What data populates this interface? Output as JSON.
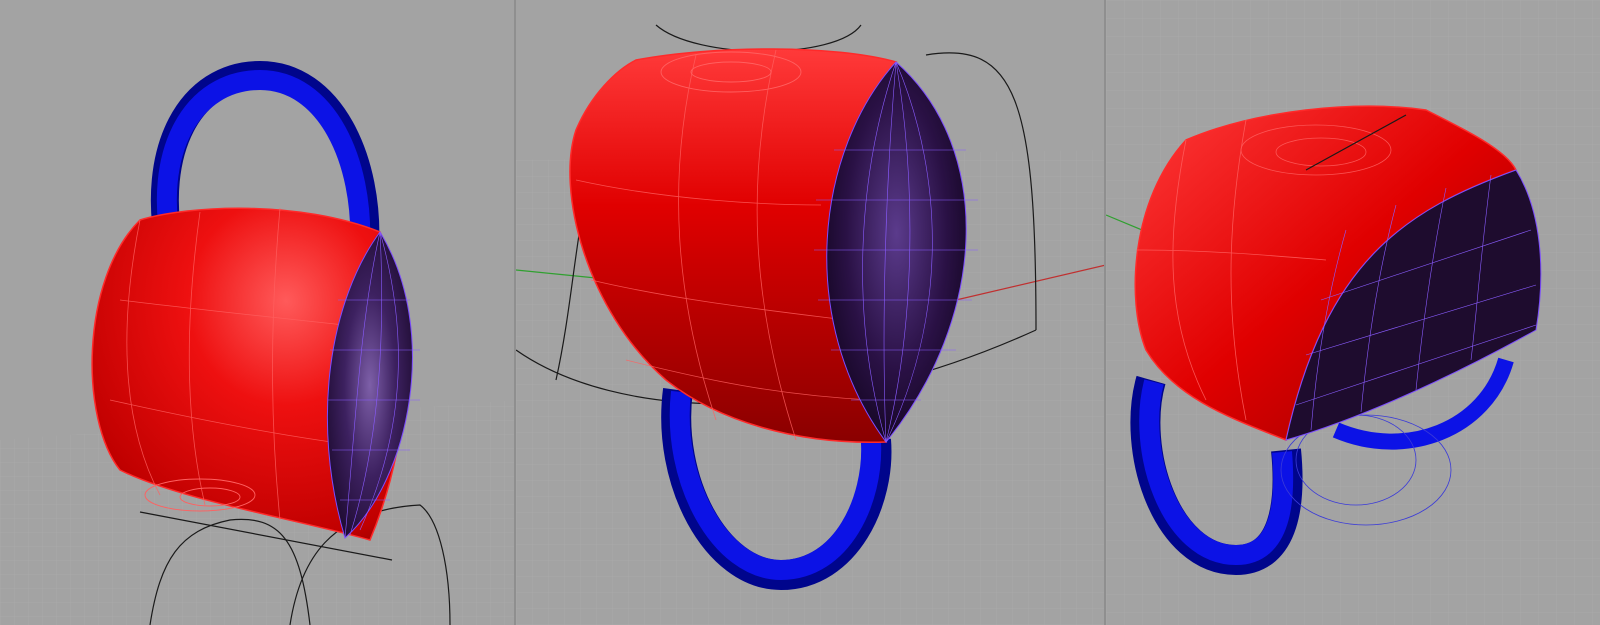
{
  "app": {
    "description_colors": {
      "viewport_background": "#a3a3a3",
      "grid_line": "#b4b4b4",
      "body_surface": "#e00000",
      "body_highlight": "#ff4a4a",
      "body_shadow": "#8a0000",
      "cut_face": "#1e0c2e",
      "cut_face_glow": "#5b3b8c",
      "isocurve_wire": "#7b4cff",
      "ring_band": "#0c12e6",
      "ring_shadow": "#00058c",
      "construction_curve": "#1a1a1a",
      "axis_x": "#c03030",
      "axis_y": "#30a030"
    }
  },
  "viewports": [
    {
      "name": "perspective-left",
      "icon": "ring-model-icon"
    },
    {
      "name": "perspective-center",
      "icon": "ring-model-icon"
    },
    {
      "name": "perspective-right",
      "icon": "ring-model-icon"
    }
  ]
}
